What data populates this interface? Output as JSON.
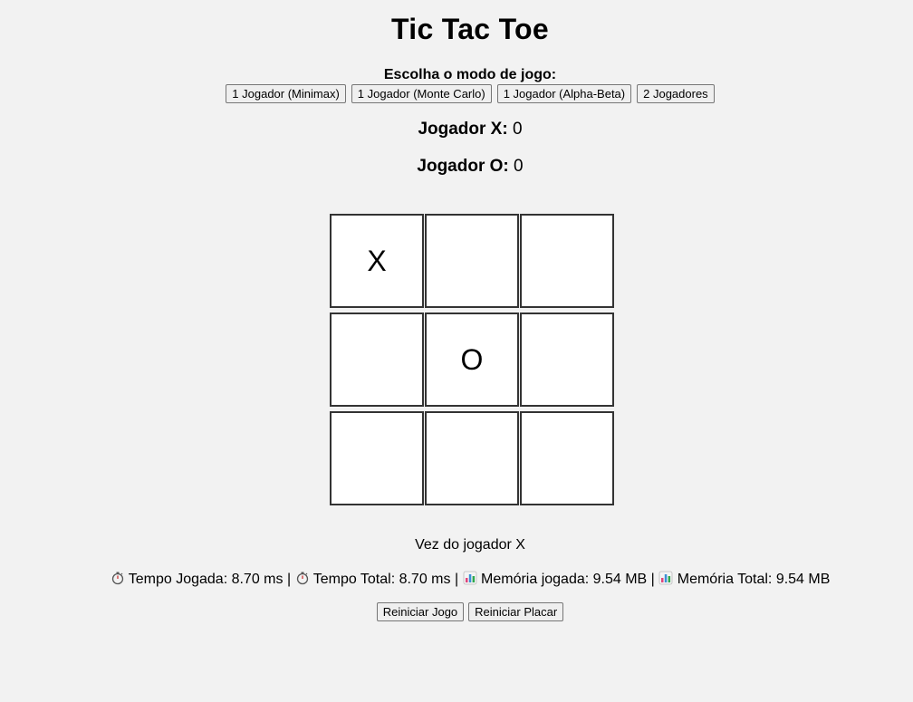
{
  "title": "Tic Tac Toe",
  "mode": {
    "label": "Escolha o modo de jogo:",
    "buttons": [
      "1 Jogador (Minimax)",
      "1 Jogador (Monte Carlo)",
      "1 Jogador (Alpha-Beta)",
      "2 Jogadores"
    ]
  },
  "score": {
    "x_label": "Jogador X:",
    "x_value": "0",
    "o_label": "Jogador O:",
    "o_value": "0"
  },
  "board": [
    "X",
    "",
    "",
    "",
    "O",
    "",
    "",
    "",
    ""
  ],
  "status": "Vez do jogador X",
  "metrics": {
    "tempo_jogada_label": "Tempo Jogada: 8.70 ms",
    "tempo_total_label": "Tempo Total: 8.70 ms",
    "memoria_jogada_label": "Memória jogada: 9.54 MB",
    "memoria_total_label": "Memória Total: 9.54 MB",
    "separator": "|"
  },
  "actions": {
    "reset_game": "Reiniciar Jogo",
    "reset_score": "Reiniciar Placar"
  },
  "icons": {
    "timer": "stopwatch-icon",
    "memory": "bar-chart-icon"
  }
}
